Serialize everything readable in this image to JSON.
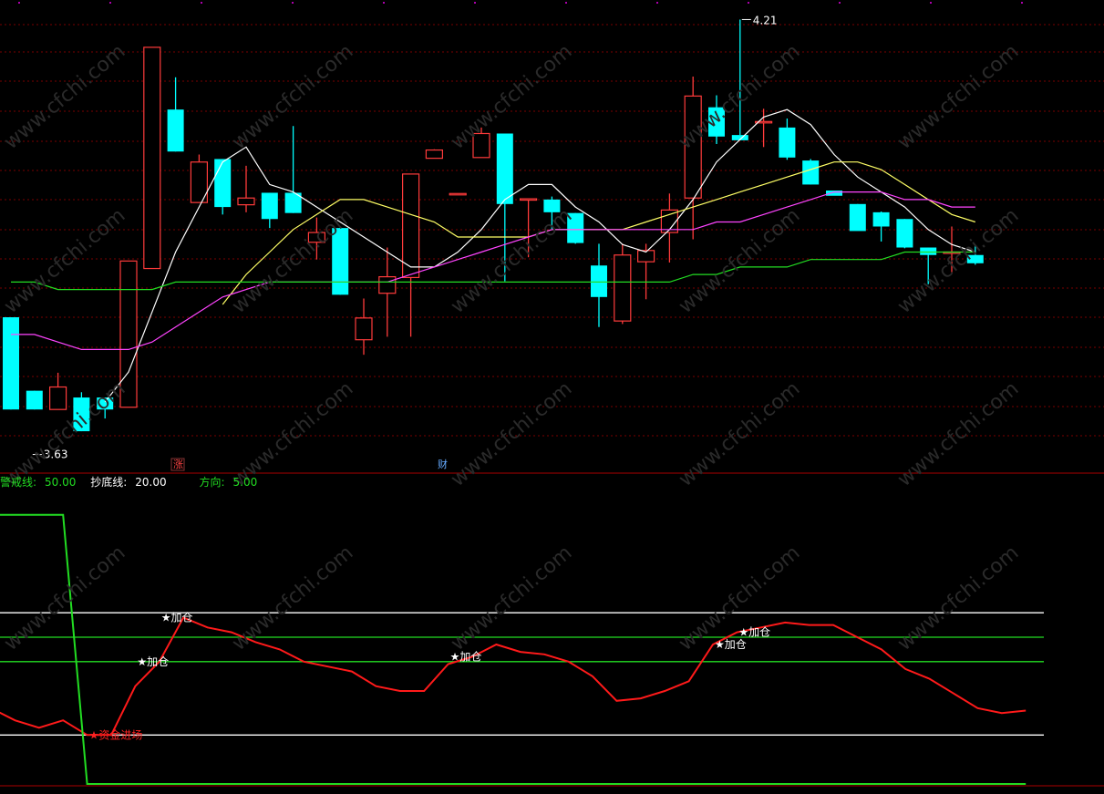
{
  "colors": {
    "up": "#ff3b3b",
    "down": "#00ffff",
    "ma5": "#ffffff",
    "ma10": "#ffff66",
    "ma20": "#ff44ff",
    "ma60": "#22dd22",
    "osc_line": "#ff1a1a",
    "step_line": "#22dd22",
    "grid": "#7a0000"
  },
  "watermark": "www.cfchi.com",
  "top_panel": {
    "max_label": "4.21",
    "min_label": "3.63",
    "marker_zhang": "涨",
    "marker_cai": "财"
  },
  "legend": {
    "item1_label": "警戒线:",
    "item1_value": "50.00",
    "item2_label": "抄底线:",
    "item2_value": "20.00",
    "item3_label": "方向:",
    "item3_value": "5.00"
  },
  "annotations": {
    "add": "★加仓",
    "entry": "★资金进场"
  },
  "chart_data": [
    {
      "type": "candlestick",
      "title": "",
      "price_range": [
        3.61,
        4.23
      ],
      "candles": [
        {
          "o": 3.813,
          "h": 3.813,
          "l": 3.69,
          "c": 3.69
        },
        {
          "o": 3.715,
          "h": 3.715,
          "l": 3.69,
          "c": 3.69
        },
        {
          "o": 3.69,
          "h": 3.739,
          "l": 3.69,
          "c": 3.72
        },
        {
          "o": 3.706,
          "h": 3.713,
          "l": 3.661,
          "c": 3.661
        },
        {
          "o": 3.706,
          "h": 3.706,
          "l": 3.678,
          "c": 3.69
        },
        {
          "o": 3.693,
          "h": 3.888,
          "l": 3.693,
          "c": 3.888
        },
        {
          "o": 3.878,
          "h": 4.173,
          "l": 3.878,
          "c": 4.173
        },
        {
          "o": 4.09,
          "h": 4.133,
          "l": 4.034,
          "c": 4.034
        },
        {
          "o": 3.966,
          "h": 4.03,
          "l": 3.966,
          "c": 4.02
        },
        {
          "o": 4.024,
          "h": 4.024,
          "l": 3.95,
          "c": 3.96
        },
        {
          "o": 3.963,
          "h": 4.015,
          "l": 3.953,
          "c": 3.972
        },
        {
          "o": 3.979,
          "h": 3.979,
          "l": 3.932,
          "c": 3.944
        },
        {
          "o": 3.979,
          "h": 4.068,
          "l": 3.952,
          "c": 3.952
        },
        {
          "o": 3.913,
          "h": 3.946,
          "l": 3.89,
          "c": 3.926
        },
        {
          "o": 3.932,
          "h": 3.932,
          "l": 3.843,
          "c": 3.843
        },
        {
          "o": 3.783,
          "h": 3.838,
          "l": 3.763,
          "c": 3.812
        },
        {
          "o": 3.845,
          "h": 3.906,
          "l": 3.787,
          "c": 3.867
        },
        {
          "o": 3.866,
          "h": 4.004,
          "l": 3.787,
          "c": 4.004
        },
        {
          "o": 4.025,
          "h": 4.037,
          "l": 4.025,
          "c": 4.036
        },
        {
          "o": 3.978,
          "h": 3.978,
          "l": 3.978,
          "c": 3.978
        },
        {
          "o": 4.026,
          "h": 4.066,
          "l": 4.026,
          "c": 4.058
        },
        {
          "o": 4.058,
          "h": 4.058,
          "l": 3.861,
          "c": 3.964
        },
        {
          "o": 3.971,
          "h": 3.971,
          "l": 3.893,
          "c": 3.971
        },
        {
          "o": 3.97,
          "h": 3.974,
          "l": 3.931,
          "c": 3.953
        },
        {
          "o": 3.952,
          "h": 3.952,
          "l": 3.911,
          "c": 3.912
        },
        {
          "o": 3.882,
          "h": 3.911,
          "l": 3.8,
          "c": 3.84
        },
        {
          "o": 3.808,
          "h": 3.911,
          "l": 3.804,
          "c": 3.896
        },
        {
          "o": 3.887,
          "h": 3.911,
          "l": 3.837,
          "c": 3.902
        },
        {
          "o": 3.926,
          "h": 3.978,
          "l": 3.886,
          "c": 3.956
        },
        {
          "o": 3.972,
          "h": 4.134,
          "l": 3.917,
          "c": 4.108
        },
        {
          "o": 4.093,
          "h": 4.109,
          "l": 4.044,
          "c": 4.054
        },
        {
          "o": 4.056,
          "h": 4.21,
          "l": 4.056,
          "c": 4.049
        },
        {
          "o": 4.074,
          "h": 4.091,
          "l": 4.04,
          "c": 4.074
        },
        {
          "o": 4.066,
          "h": 4.078,
          "l": 4.023,
          "c": 4.026
        },
        {
          "o": 4.022,
          "h": 4.024,
          "l": 3.99,
          "c": 3.99
        },
        {
          "o": 3.982,
          "h": 3.982,
          "l": 3.982,
          "c": 3.975
        },
        {
          "o": 3.964,
          "h": 3.964,
          "l": 3.953,
          "c": 3.928
        },
        {
          "o": 3.953,
          "h": 3.954,
          "l": 3.914,
          "c": 3.934
        },
        {
          "o": 3.944,
          "h": 3.944,
          "l": 3.905,
          "c": 3.906
        },
        {
          "o": 3.906,
          "h": 3.906,
          "l": 3.857,
          "c": 3.896
        },
        {
          "o": 3.9,
          "h": 3.934,
          "l": 3.873,
          "c": 3.9
        },
        {
          "o": 3.896,
          "h": 3.909,
          "l": 3.883,
          "c": 3.885
        }
      ],
      "ma_lines": [
        {
          "name": "MA5",
          "color_key": "ma5",
          "values": [
            null,
            null,
            null,
            null,
            3.7,
            3.74,
            3.82,
            3.9,
            3.96,
            4.02,
            4.04,
            3.99,
            3.98,
            3.96,
            3.94,
            3.92,
            3.9,
            3.88,
            3.88,
            3.9,
            3.93,
            3.97,
            3.99,
            3.99,
            3.96,
            3.94,
            3.91,
            3.9,
            3.93,
            3.97,
            4.02,
            4.05,
            4.08,
            4.09,
            4.07,
            4.03,
            4.0,
            3.98,
            3.96,
            3.93,
            3.91,
            3.9
          ]
        },
        {
          "name": "MA10",
          "color_key": "ma10",
          "values": [
            null,
            null,
            null,
            null,
            null,
            null,
            null,
            null,
            null,
            3.83,
            3.87,
            3.9,
            3.93,
            3.95,
            3.97,
            3.97,
            3.96,
            3.95,
            3.94,
            3.92,
            3.92,
            3.92,
            3.92,
            3.93,
            3.93,
            3.93,
            3.93,
            3.94,
            3.95,
            3.96,
            3.97,
            3.98,
            3.99,
            4.0,
            4.01,
            4.02,
            4.02,
            4.01,
            3.99,
            3.97,
            3.95,
            3.94
          ]
        },
        {
          "name": "MA20",
          "color_key": "ma20",
          "values": [
            3.79,
            3.79,
            3.78,
            3.77,
            3.77,
            3.77,
            3.78,
            3.8,
            3.82,
            3.84,
            3.85,
            3.86,
            3.86,
            3.86,
            3.86,
            3.86,
            3.86,
            3.87,
            3.88,
            3.89,
            3.9,
            3.91,
            3.92,
            3.93,
            3.93,
            3.93,
            3.93,
            3.93,
            3.93,
            3.93,
            3.94,
            3.94,
            3.95,
            3.96,
            3.97,
            3.98,
            3.98,
            3.98,
            3.97,
            3.97,
            3.96,
            3.96
          ]
        },
        {
          "name": "MA60",
          "color_key": "ma60",
          "values": [
            3.86,
            3.86,
            3.85,
            3.85,
            3.85,
            3.85,
            3.85,
            3.86,
            3.86,
            3.86,
            3.86,
            3.86,
            3.86,
            3.86,
            3.86,
            3.86,
            3.86,
            3.86,
            3.86,
            3.86,
            3.86,
            3.86,
            3.86,
            3.86,
            3.86,
            3.86,
            3.86,
            3.86,
            3.86,
            3.87,
            3.87,
            3.88,
            3.88,
            3.88,
            3.89,
            3.89,
            3.89,
            3.89,
            3.9,
            3.9,
            3.9,
            3.9
          ]
        }
      ]
    },
    {
      "type": "line",
      "title": "",
      "ylim": [
        0,
        120
      ],
      "hlines": [
        {
          "value": 70,
          "color_key": "ma5"
        },
        {
          "value": 60,
          "color_key": "ma60"
        },
        {
          "value": 50,
          "color_key": "ma60"
        },
        {
          "value": 20,
          "color_key": "ma5"
        }
      ],
      "series": [
        {
          "color_key": "osc_line",
          "values": [
            31,
            26,
            23,
            26,
            20,
            20,
            40,
            50,
            68,
            64,
            62,
            58,
            55,
            50,
            48,
            46,
            40,
            38,
            38,
            49,
            52,
            57,
            54,
            53,
            50,
            44,
            34,
            35,
            38,
            42,
            57,
            62,
            64,
            66,
            65,
            65,
            60,
            55,
            47,
            43,
            37,
            31,
            29,
            30
          ]
        },
        {
          "color_key": "step_line",
          "values": [
            110,
            110,
            110,
            110,
            0,
            0,
            0,
            0,
            0,
            0,
            0,
            0,
            0,
            0,
            0,
            0,
            0,
            0,
            0,
            0,
            0,
            0,
            0,
            0,
            0,
            0,
            0,
            0,
            0,
            0,
            0,
            0,
            0,
            0,
            0,
            0,
            0,
            0,
            0,
            0,
            0,
            0,
            0,
            0
          ]
        }
      ],
      "markers": [
        {
          "index": 4,
          "value": 20,
          "label": "★资金进场"
        },
        {
          "index": 6,
          "value": 50,
          "label": "★加仓"
        },
        {
          "index": 7,
          "value": 68,
          "label": "★加仓"
        },
        {
          "index": 19,
          "value": 52,
          "label": "★加仓"
        },
        {
          "index": 30,
          "value": 57,
          "label": "★加仓"
        },
        {
          "index": 31,
          "value": 62,
          "label": "★加仓"
        }
      ]
    }
  ]
}
